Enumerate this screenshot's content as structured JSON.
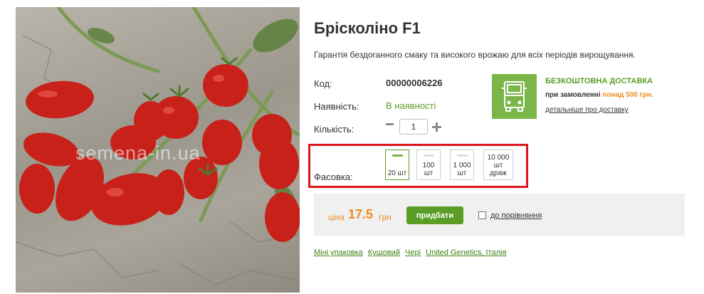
{
  "product": {
    "title": "Брісколіно F1",
    "description": "Гарантія бездоганного смаку та високого врожаю для всіх періодів вирощування.",
    "photo_watermark": "semena-in.ua"
  },
  "details": {
    "code_label": "Код:",
    "code_value": "00000006226",
    "availability_label": "Наявність:",
    "availability_value": "В наявності",
    "quantity_label": "Кількість:",
    "quantity_value": "1"
  },
  "delivery": {
    "title": "БЕЗКОШТОВНА ДОСТАВКА",
    "condition_prefix": "при замовленні",
    "condition_highlight": "понад 500 грн.",
    "details_link": "детальніше про доставку",
    "icon": "truck-icon"
  },
  "packaging": {
    "label": "Фасовка:",
    "options": [
      {
        "label": "20 шт",
        "selected": true
      },
      {
        "label": "100 шт",
        "selected": false
      },
      {
        "label": "1 000 шт",
        "selected": false
      },
      {
        "label": "10 000 шт драж",
        "selected": false
      }
    ],
    "options_display": [
      [
        "20 шт"
      ],
      [
        "100",
        "шт"
      ],
      [
        "1 000",
        "шт"
      ],
      [
        "10 000",
        "шт",
        "драж"
      ]
    ]
  },
  "purchase": {
    "price_word": "ціна",
    "price_value": "17.5",
    "currency": "грн",
    "buy_label": "придбати",
    "compare_label": "до порівняння"
  },
  "tags": [
    "Міні упаковка",
    "Кущовий",
    "Чері",
    "United Genetics, Італія"
  ],
  "colors": {
    "accent_green": "#5a9e27",
    "delivery_box_green": "#7ab648",
    "price_orange": "#f08c1e",
    "highlight_frame_red": "#e0141e"
  }
}
